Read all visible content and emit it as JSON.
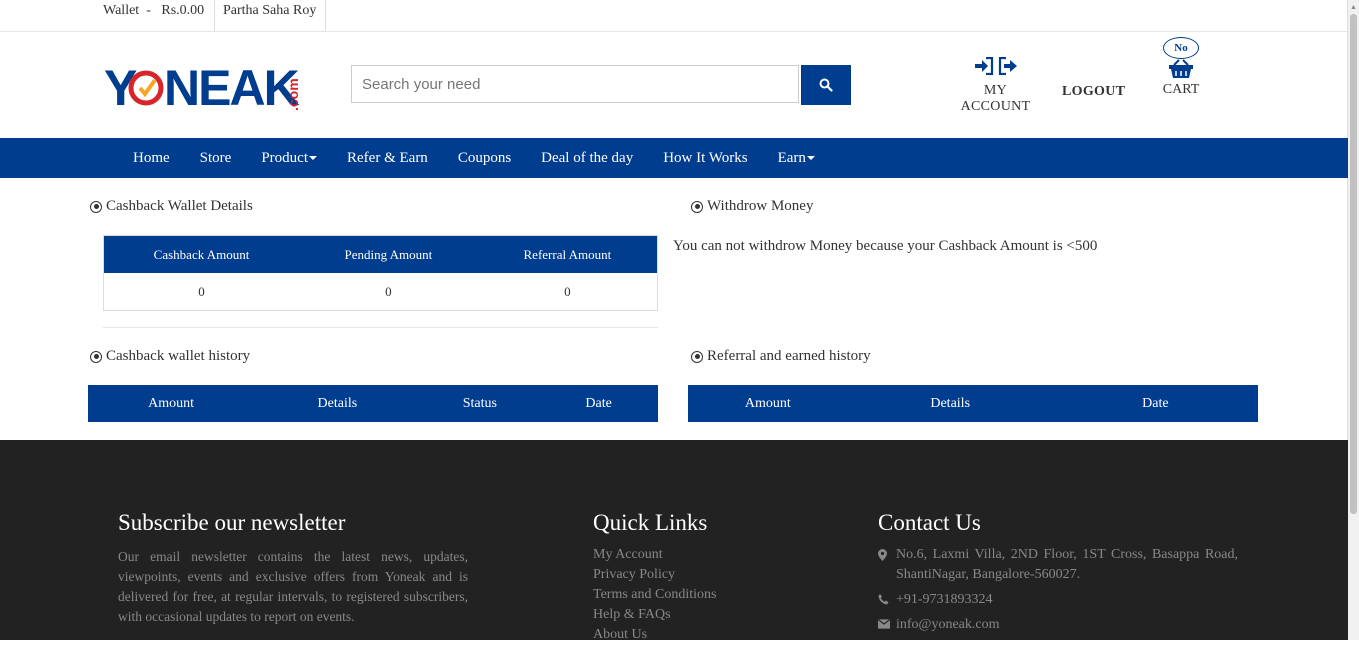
{
  "topbar": {
    "wallet_label": "Wallet  -   Rs.0.00",
    "user_name": "Partha Saha Roy"
  },
  "logo": {
    "text": "YONEAK",
    "suffix": ".com"
  },
  "search": {
    "placeholder": "Search your need"
  },
  "header": {
    "my_account": "MY ACCOUNT",
    "logout": "LOGOUT",
    "cart_badge": "No",
    "cart": "CART"
  },
  "nav": {
    "items": [
      "Home",
      "Store",
      "Product",
      "Refer & Earn",
      "Coupons",
      "Deal of the day",
      "How It Works",
      "Earn"
    ]
  },
  "cashback_wallet": {
    "title": "Cashback Wallet Details",
    "headers": [
      "Cashback Amount",
      "Pending Amount",
      "Referral Amount"
    ],
    "values": [
      "0",
      "0",
      "0"
    ]
  },
  "withdraw": {
    "title": "Withdrow Money",
    "message": "You can not withdrow Money because your Cashback Amount is <500"
  },
  "cashback_history": {
    "title": "Cashback wallet history",
    "headers": [
      "Amount",
      "Details",
      "Status",
      "Date"
    ]
  },
  "referral_history": {
    "title": "Referral and earned history",
    "headers": [
      "Amount",
      "Details",
      "Date"
    ]
  },
  "footer": {
    "newsletter_title": "Subscribe our newsletter",
    "newsletter_text": "Our email newsletter contains the latest news, updates, viewpoints, events and exclusive offers from Yoneak and is delivered for free, at regular intervals, to registered subscribers, with occasional updates to report on events.",
    "quick_links_title": "Quick Links",
    "quick_links": [
      "My Account",
      "Privacy Policy",
      "Terms and Conditions",
      "Help & FAQs",
      "About Us"
    ],
    "contact_title": "Contact Us",
    "address": "No.6, Laxmi Villa, 2ND Floor, 1ST Cross, Basappa Road, ShantiNagar, Bangalore-560027.",
    "phone": "+91-9731893324",
    "email": "info@yoneak.com"
  },
  "colors": {
    "primary": "#003d8f",
    "logo_red": "#d7262b",
    "footer_bg": "#222222"
  }
}
